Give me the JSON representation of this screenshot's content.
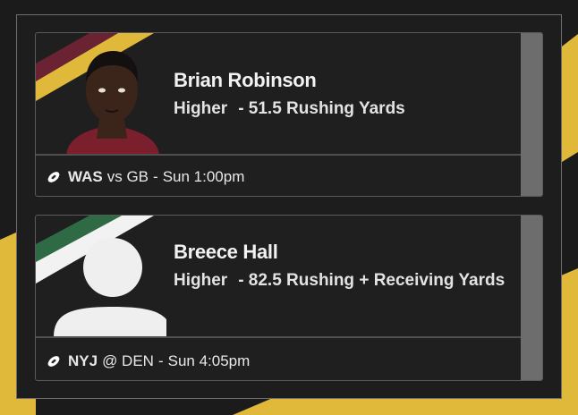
{
  "colors": {
    "background": "#1b1b1b",
    "card": "#1f1f1f",
    "accent_yellow": "#e0b93a",
    "was_burgundy": "#6b2233",
    "nyj_green": "#2e6b45"
  },
  "picks": [
    {
      "player": "Brian Robinson",
      "direction": "Higher",
      "line": "- 51.5 Rushing Yards",
      "team": "WAS",
      "matchup": "vs GB",
      "separator": "-",
      "time": "Sun 1:00pm",
      "icon": "football-icon",
      "avatar": "player-photo"
    },
    {
      "player": "Breece Hall",
      "direction": "Higher",
      "line": "- 82.5 Rushing + Receiving Yards",
      "team": "NYJ",
      "matchup": "@ DEN",
      "separator": "-",
      "time": "Sun 4:05pm",
      "icon": "football-icon",
      "avatar": "placeholder-silhouette"
    }
  ]
}
